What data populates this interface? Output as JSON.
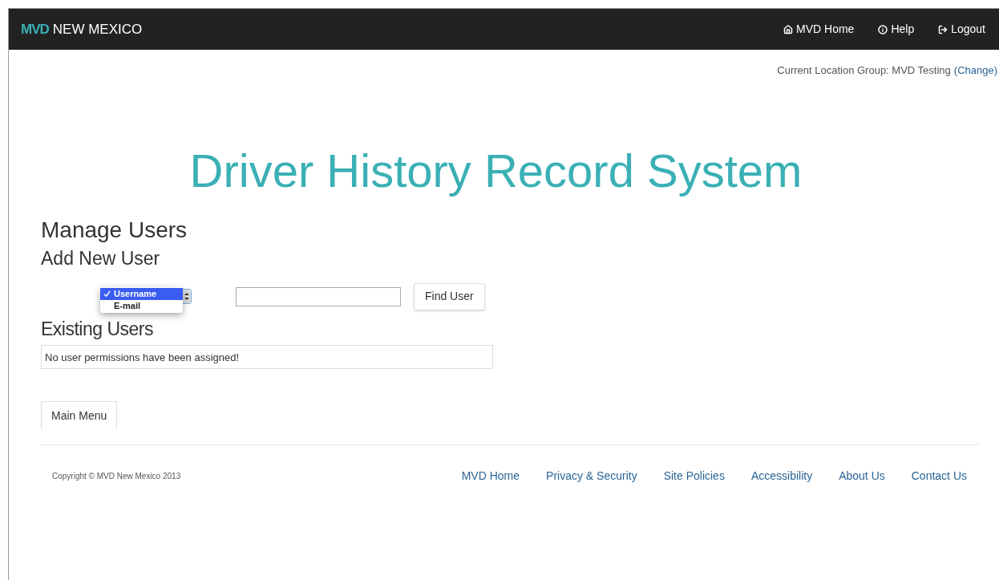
{
  "navbar": {
    "brand_mark": "MVD",
    "brand_text": "NEW MEXICO",
    "links": [
      {
        "kind": "home",
        "label": "MVD Home"
      },
      {
        "kind": "help",
        "label": "Help"
      },
      {
        "kind": "logout",
        "label": "Logout"
      }
    ]
  },
  "location": {
    "label": "Current Location Group: MVD Testing",
    "link": "(Change)"
  },
  "title": "Driver History Record System",
  "heading": "Manage Users",
  "add_user": {
    "heading": "Add New User",
    "search_type": {
      "expanded": true,
      "options": [
        {
          "label": "Username",
          "selected": true
        },
        {
          "label": "E-mail",
          "selected": false
        }
      ]
    },
    "button": "Find User"
  },
  "existing_users": {
    "heading": "Existing Users",
    "message": "No user permissions have been assigned!"
  },
  "main_menu_button": "Main Menu",
  "footer": {
    "copyright": "Copyright © MVD New Mexico 2013",
    "links": [
      "MVD Home",
      "Privacy & Security",
      "Site Policies",
      "Accessibility",
      "About Us",
      "Contact Us"
    ]
  }
}
